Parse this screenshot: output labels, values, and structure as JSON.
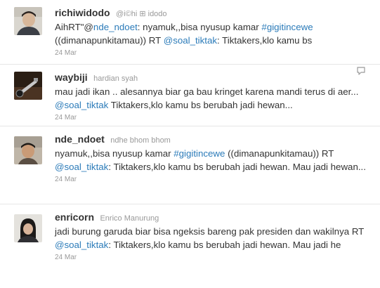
{
  "tweets": [
    {
      "screen_name": "richiwidodo",
      "full_name": "@i©hi ⊞ idodo",
      "text_parts": [
        "AihRT\"@",
        "nde_ndoet",
        ": nyamuk,,bisa nyusup kamar ",
        "#gigitincewe",
        " ((dimanapunkitamau)) RT ",
        "@soal_tiktak",
        ": Tiktakers,klo kamu bs"
      ],
      "time": "24 Mar"
    },
    {
      "screen_name": "waybiji",
      "full_name": "hardian syah",
      "text_parts": [
        "mau jadi ikan .. alesannya biar ga bau kringet karena mandi terus di aer... ",
        "@soal_tiktak",
        " Tiktakers,klo kamu bs berubah jadi hewan..."
      ],
      "time": "24 Mar",
      "reply_icon": "reply-icon"
    },
    {
      "screen_name": "nde_ndoet",
      "full_name": "ndhe bhom bhom",
      "text_parts": [
        "nyamuk,,bisa nyusup kamar ",
        "#gigitincewe",
        " ((dimanapunkitamau)) RT ",
        "@soal_tiktak",
        ": Tiktakers,klo kamu bs berubah jadi hewan. Mau jadi hewan..."
      ],
      "time": "24 Mar"
    },
    {
      "screen_name": "enricorn",
      "full_name": "Enrico Manurung",
      "text_parts": [
        "jadi burung garuda biar bisa ngeksis bareng pak presiden dan wakilnya RT ",
        "@soal_tiktak",
        ": Tiktakers,klo kamu bs berubah jadi hewan. Mau jadi he"
      ],
      "time": "24 Mar"
    }
  ],
  "colors": {
    "link": "#2b7bb9",
    "muted": "#999999",
    "text": "#333333",
    "divider": "#e6e6e6"
  }
}
